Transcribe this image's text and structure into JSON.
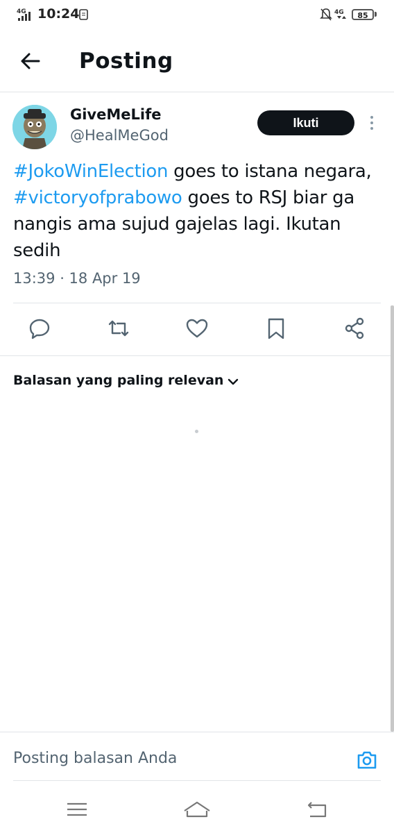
{
  "status_bar": {
    "time": "10:24",
    "network_left": "4G",
    "network_right": "4G",
    "battery": "85"
  },
  "header": {
    "title": "Posting"
  },
  "post": {
    "author_name": "GiveMeLife",
    "author_handle": "@HealMeGod",
    "follow_label": "Ikuti",
    "text_parts": [
      {
        "text": "#JokoWinElection",
        "type": "hashtag"
      },
      {
        "text": " goes to istana negara, ",
        "type": "plain"
      },
      {
        "text": "#victoryofprabowo",
        "type": "hashtag"
      },
      {
        "text": " goes to RSJ biar ga nangis ama sujud gajelas lagi. Ikutan sedih",
        "type": "plain"
      }
    ],
    "timestamp": "13:39 · 18 Apr 19"
  },
  "actions": {
    "icons": [
      "reply-icon",
      "retweet-icon",
      "like-icon",
      "bookmark-icon",
      "share-icon"
    ]
  },
  "replies": {
    "sort_label": "Balasan yang paling relevan"
  },
  "reply_bar": {
    "placeholder": "Posting balasan Anda"
  },
  "colors": {
    "accent": "#1d9bf0",
    "text": "#0f1419",
    "secondary": "#536471",
    "button": "#0f1419"
  }
}
